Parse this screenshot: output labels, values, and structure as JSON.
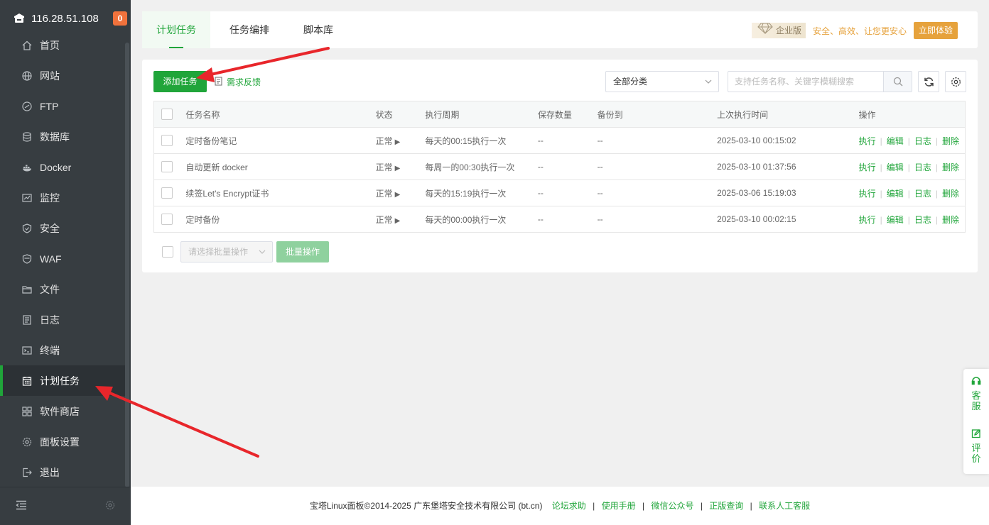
{
  "sidebar": {
    "server_ip": "116.28.51.108",
    "notice_count": "0",
    "items": [
      {
        "label": "首页",
        "icon": "home-icon"
      },
      {
        "label": "网站",
        "icon": "globe-icon"
      },
      {
        "label": "FTP",
        "icon": "ftp-icon"
      },
      {
        "label": "数据库",
        "icon": "database-icon"
      },
      {
        "label": "Docker",
        "icon": "docker-icon"
      },
      {
        "label": "监控",
        "icon": "monitor-icon"
      },
      {
        "label": "安全",
        "icon": "shield-icon"
      },
      {
        "label": "WAF",
        "icon": "waf-shield-icon"
      },
      {
        "label": "文件",
        "icon": "folder-icon"
      },
      {
        "label": "日志",
        "icon": "log-icon"
      },
      {
        "label": "终端",
        "icon": "terminal-icon"
      },
      {
        "label": "计划任务",
        "icon": "calendar-icon"
      },
      {
        "label": "软件商店",
        "icon": "apps-icon"
      },
      {
        "label": "面板设置",
        "icon": "settings-icon"
      },
      {
        "label": "退出",
        "icon": "logout-icon"
      }
    ],
    "active_item": "计划任务"
  },
  "tabs": [
    {
      "label": "计划任务",
      "active": true
    },
    {
      "label": "任务编排",
      "active": false
    },
    {
      "label": "脚本库",
      "active": false
    }
  ],
  "promo": {
    "edition": "企业版",
    "slogan": "安全、高效、让您更安心",
    "try_label": "立即体验"
  },
  "toolbar": {
    "add_task_label": "添加任务",
    "feedback_label": "需求反馈",
    "category_value": "全部分类",
    "search_placeholder": "支持任务名称、关键字模糊搜索"
  },
  "table": {
    "headers": {
      "name": "任务名称",
      "status": "状态",
      "cycle": "执行周期",
      "keep": "保存数量",
      "backup_to": "备份到",
      "last_run": "上次执行时间",
      "actions": "操作"
    },
    "rows": [
      {
        "name": "定时备份笔记",
        "status": "正常",
        "cycle": "每天的00:15执行一次",
        "keep": "--",
        "backup_to": "--",
        "last_run": "2025-03-10 00:15:02"
      },
      {
        "name": "自动更新 docker",
        "status": "正常",
        "cycle": "每周一的00:30执行一次",
        "keep": "--",
        "backup_to": "--",
        "last_run": "2025-03-10 01:37:56"
      },
      {
        "name": "续签Let's Encrypt证书",
        "status": "正常",
        "cycle": "每天的15:19执行一次",
        "keep": "--",
        "backup_to": "--",
        "last_run": "2025-03-06 15:19:03"
      },
      {
        "name": "定时备份",
        "status": "正常",
        "cycle": "每天的00:00执行一次",
        "keep": "--",
        "backup_to": "--",
        "last_run": "2025-03-10 00:02:15"
      }
    ],
    "row_actions": {
      "run": "执行",
      "edit": "编辑",
      "log": "日志",
      "delete": "删除"
    }
  },
  "batch": {
    "select_placeholder": "请选择批量操作",
    "button_label": "批量操作"
  },
  "footer": {
    "copyright": "宝塔Linux面板©2014-2025 广东堡塔安全技术有限公司 (bt.cn)",
    "links": [
      "论坛求助",
      "使用手册",
      "微信公众号",
      "正版查询",
      "联系人工客服"
    ]
  },
  "float_service": {
    "service_label": "客服",
    "review_label": "评价"
  },
  "colors": {
    "brand_green": "#20a53a",
    "sidebar_bg": "#373d41",
    "annotation_arrow": "#e8262b",
    "promo_orange": "#e6a23c"
  }
}
